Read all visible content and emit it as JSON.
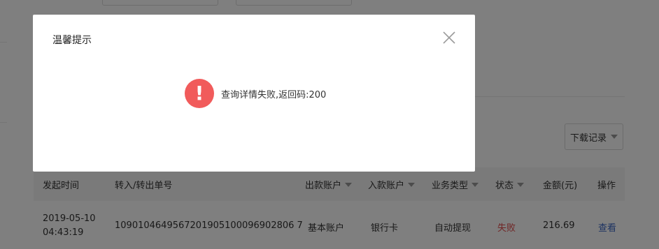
{
  "modal": {
    "title": "温馨提示",
    "message": "查询详情失败,返回码:200",
    "close_icon": "close-icon",
    "alert_icon": "exclamation-icon",
    "alert_glyph": "!"
  },
  "toolbar": {
    "download_label": "下载记录"
  },
  "table": {
    "headers": [
      "发起时间",
      "转入/转出单号",
      "出款账户",
      "入款账户",
      "业务类型",
      "状态",
      "金额(元)",
      "操作"
    ],
    "rows": [
      {
        "date": "2019-05-10",
        "time": "04:43:19",
        "order_no": "1090104649567201905100096902806 7",
        "from_account": "基本账户",
        "to_account": "银行卡",
        "business_type": "自动提现",
        "status": "失败",
        "amount": "216.69",
        "action": "查看"
      }
    ]
  },
  "colors": {
    "status_fail": "#e04a4a",
    "link": "#3a66c4",
    "alert_red": "#f15b5b",
    "overlay": "rgba(0,0,0,0.5)"
  }
}
